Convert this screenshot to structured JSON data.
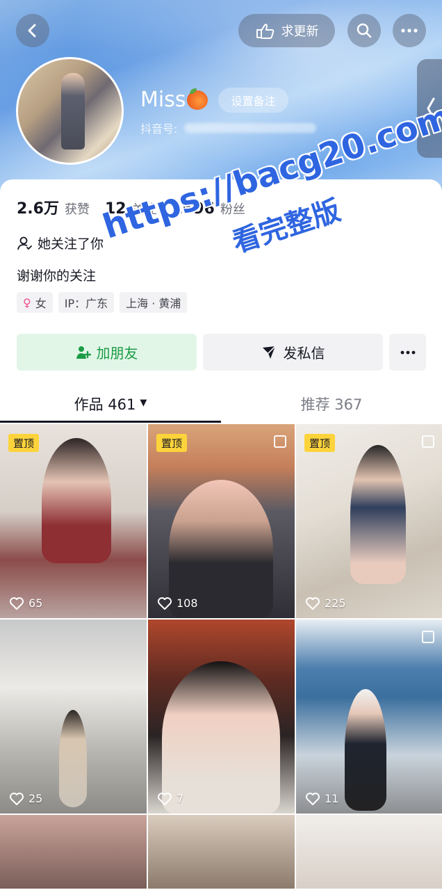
{
  "header": {
    "update_label": "求更新",
    "username": "Miss",
    "remark_label": "设置备注",
    "douyin_id_label": "抖音号:"
  },
  "stats": {
    "likes_value": "2.6万",
    "likes_label": "获赞",
    "following_value": "12",
    "following_label": "关注",
    "followers_value": "1696",
    "followers_label": "粉丝"
  },
  "profile": {
    "follows_you": "她关注了你",
    "bio": "谢谢你的关注",
    "tags": {
      "gender": "女",
      "ip": "IP：广东",
      "location": "上海 · 黄浦"
    }
  },
  "actions": {
    "add_friend": "加朋友",
    "message": "发私信"
  },
  "tabs": {
    "works_label": "作品 461",
    "recommend_label": "推荐 367"
  },
  "videos": {
    "pin_label": "置顶",
    "likes": [
      "65",
      "108",
      "225",
      "25",
      "7",
      "11"
    ]
  },
  "watermark": {
    "line1": "https://bacg20.com",
    "line2": "看完整版"
  },
  "colors": {
    "accent_green": "#1c9c45",
    "pin_yellow": "#fdd33b",
    "watermark_blue": "#2f65e0"
  }
}
